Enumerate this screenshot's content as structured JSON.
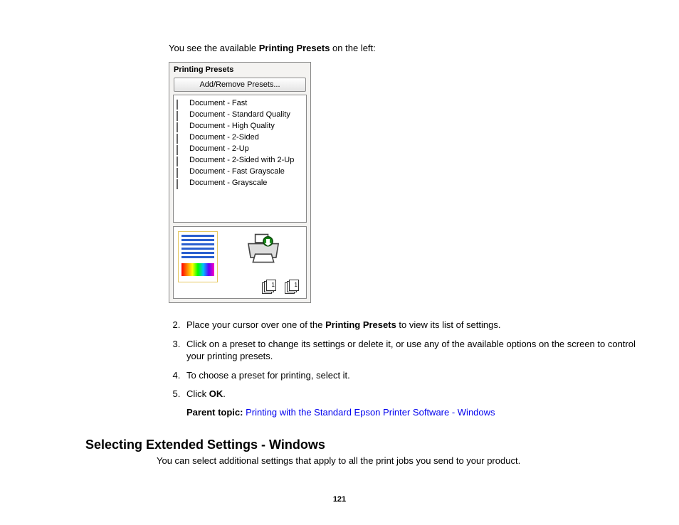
{
  "intro": {
    "prefix": "You see the available ",
    "bold": "Printing Presets",
    "suffix": " on the left:"
  },
  "panel": {
    "title": "Printing Presets",
    "button": "Add/Remove Presets...",
    "presets": [
      "Document - Fast",
      "Document - Standard Quality",
      "Document - High Quality",
      "Document - 2-Sided",
      "Document - 2-Up",
      "Document - 2-Sided with 2-Up",
      "Document - Fast Grayscale",
      "Document - Grayscale"
    ]
  },
  "steps": {
    "s2": {
      "prefix": "Place your cursor over one of the ",
      "bold": "Printing Presets",
      "suffix": " to view its list of settings."
    },
    "s3": "Click on a preset to change its settings or delete it, or use any of the available options on the screen to control your printing presets.",
    "s4": "To choose a preset for printing, select it.",
    "s5": {
      "prefix": "Click ",
      "bold": "OK",
      "suffix": "."
    }
  },
  "parent_topic": {
    "label": "Parent topic: ",
    "link": "Printing with the Standard Epson Printer Software - Windows"
  },
  "section": {
    "heading": "Selecting Extended Settings - Windows",
    "text": "You can select additional settings that apply to all the print jobs you send to your product."
  },
  "page_number": "121"
}
